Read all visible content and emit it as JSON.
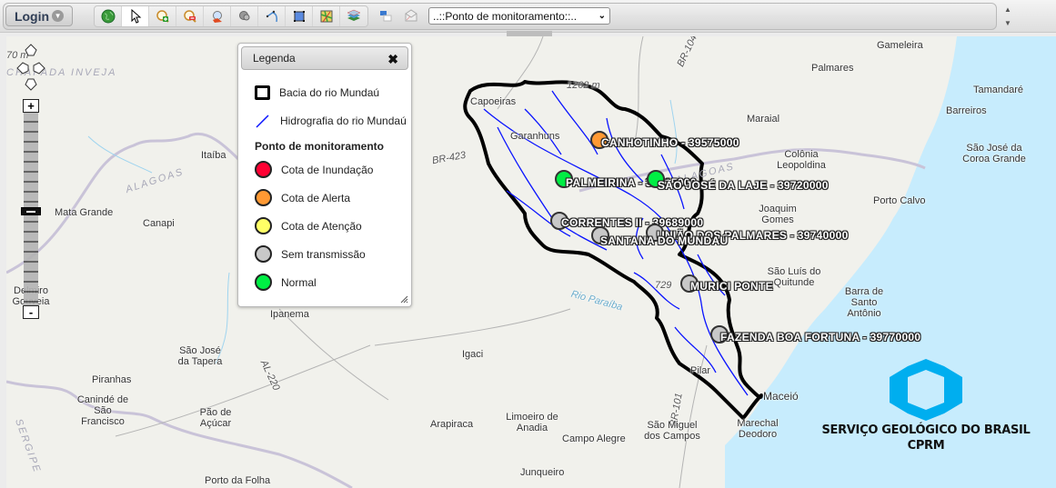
{
  "toolbar": {
    "login_label": "Login",
    "tools": [
      {
        "name": "full-extent",
        "icon": "globe-icon",
        "active": false
      },
      {
        "name": "select",
        "icon": "cursor-arrow-icon",
        "active": true
      },
      {
        "name": "zoom-in",
        "icon": "zoom-in-icon",
        "active": false
      },
      {
        "name": "zoom-out",
        "icon": "zoom-out-icon",
        "active": false
      },
      {
        "name": "identify",
        "icon": "identify-icon",
        "active": false
      },
      {
        "name": "query",
        "icon": "query-icon",
        "active": false
      },
      {
        "name": "measure-line",
        "icon": "measure-line-icon",
        "active": false
      },
      {
        "name": "measure-area",
        "icon": "measure-area-icon",
        "active": false
      },
      {
        "name": "basemap",
        "icon": "basemap-icon",
        "active": false
      },
      {
        "name": "layers",
        "icon": "layers-icon",
        "active": false
      }
    ],
    "extra_tools": [
      {
        "name": "print",
        "icon": "windows-icon"
      },
      {
        "name": "email",
        "icon": "envelope-icon"
      }
    ],
    "station_select": {
      "selected": "..::Ponto de monitoramento::.."
    }
  },
  "map": {
    "elevation_labels": [
      "1262 m",
      "70 m",
      "729"
    ],
    "state_labels": [
      "ALAGOAS",
      "ALAGOAS",
      "SERGIPE",
      "CHAPADA INVEJA"
    ],
    "road_labels": [
      "BR-423",
      "BR-104",
      "BR-101",
      "AL-220"
    ],
    "river_labels": [
      "Rio Paraíba"
    ],
    "places": [
      "Gameleira",
      "Palmares",
      "Tamandaré",
      "Barreiros",
      "Maraial",
      "Colônia Leopoldina",
      "São José da Coroa Grande",
      "Porto Calvo",
      "Joaquim Gomes",
      "São Luís do Quitunde",
      "Barra de Santo Antônio",
      "Maceió",
      "Marechal Deodoro",
      "Pilar",
      "São Miguel dos Campos",
      "Campo Alegre",
      "Junqueiro",
      "Limoeiro de Anadia",
      "Arapiraca",
      "Igaci",
      "Ipanema",
      "São José da Tapera",
      "Piranhas",
      "Canindé de São Francisco",
      "Pão de Açúcar",
      "Porto da Folha",
      "Delmiro Gouveia",
      "Mata Grande",
      "Canapi",
      "Itaíba",
      "Garanhuns",
      "Capoeiras",
      "União dos Palmares"
    ],
    "stations": [
      {
        "name": "CANHOTINHO - 39575000",
        "status": "alerta"
      },
      {
        "name": "PALMEIRINA - 39715000",
        "status": "normal"
      },
      {
        "name": "SÃO JOSÉ DA LAJE - 39720000",
        "status": "normal"
      },
      {
        "name": "CORRENTES II - 39689000",
        "status": "sem_transmissao"
      },
      {
        "name": "SANTANA DO MUNDAÚ",
        "status": "sem_transmissao"
      },
      {
        "name": "UNIÃO DOS PALMARES - 39740000",
        "status": "sem_transmissao"
      },
      {
        "name": "MURICI PONTE",
        "status": "sem_transmissao"
      },
      {
        "name": "FAZENDA BOA FORTUNA - 39770000",
        "status": "sem_transmissao"
      }
    ]
  },
  "legend": {
    "title": "Legenda",
    "basin_label": "Bacia do rio Mundaú",
    "hydro_label": "Hidrografia do rio Mundaú",
    "subtitle": "Ponto de monitoramento",
    "statuses": [
      {
        "key": "inundacao",
        "label": "Cota de Inundação",
        "color": "#ff0033"
      },
      {
        "key": "alerta",
        "label": "Cota de Alerta",
        "color": "#ff9933"
      },
      {
        "key": "atencao",
        "label": "Cota de Atenção",
        "color": "#ffff66"
      },
      {
        "key": "sem_transmissao",
        "label": "Sem transmissão",
        "color": "#c8c8c8"
      },
      {
        "key": "normal",
        "label": "Normal",
        "color": "#00ee44"
      }
    ]
  },
  "logo": {
    "line1": "SERVIÇO GEOLÓGICO DO BRASIL",
    "line2": "CPRM",
    "color": "#00aeef"
  },
  "colors": {
    "basin": "#000000",
    "hydro": "#0a14ff",
    "sea": "#c7ecfd"
  }
}
